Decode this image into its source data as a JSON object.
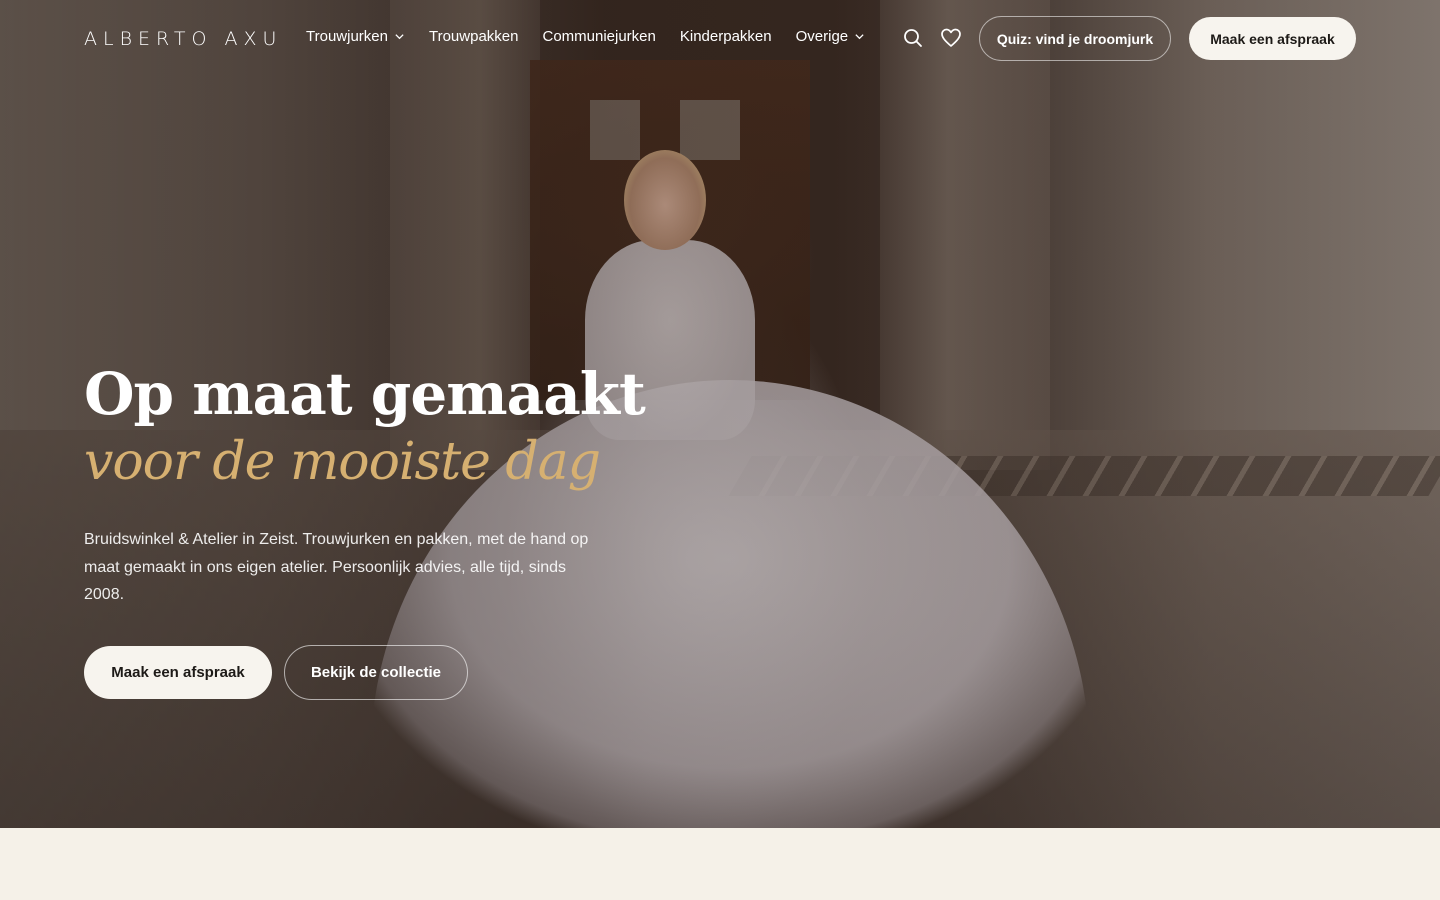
{
  "brand": {
    "logo_text": "ALBERTO AXU"
  },
  "nav": {
    "items": [
      {
        "label": "Trouwjurken",
        "has_dropdown": true
      },
      {
        "label": "Trouwpakken",
        "has_dropdown": false
      },
      {
        "label": "Communiejurken",
        "has_dropdown": false
      },
      {
        "label": "Kinderpakken",
        "has_dropdown": false
      },
      {
        "label": "Overige",
        "has_dropdown": true
      }
    ],
    "icons": [
      "search-icon",
      "heart-icon",
      "chevron-down-icon"
    ],
    "quiz_label": "Quiz: vind je droomjurk",
    "appointment_label": "Maak een afspraak"
  },
  "hero": {
    "headline": "Op maat gemaakt",
    "script_line": "voor de mooiste dag",
    "intro": "Bruidswinkel & Atelier in Zeist. Trouwjurken en pakken, met de hand op maat gemaakt in ons eigen atelier. Persoonlijk advies, alle tijd, sinds 2008.",
    "primary_cta": "Maak een afspraak",
    "secondary_cta": "Bekijk de collectie"
  },
  "colors": {
    "accent_gold": "#d6b071",
    "button_light": "#f7f4ee",
    "page_background": "#f5f1e8",
    "text_dark": "#1d1a17"
  }
}
